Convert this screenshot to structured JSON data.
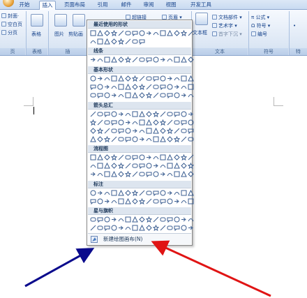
{
  "ribbon": {
    "tabs": [
      {
        "label": "开始",
        "active": false
      },
      {
        "label": "插入",
        "active": true
      },
      {
        "label": "页面布局",
        "active": false
      },
      {
        "label": "引用",
        "active": false
      },
      {
        "label": "邮件",
        "active": false
      },
      {
        "label": "审阅",
        "active": false
      },
      {
        "label": "视图",
        "active": false
      },
      {
        "label": "开发工具",
        "active": false
      }
    ],
    "pages_group": {
      "label": "页",
      "cover": "封面",
      "blank": "空白页",
      "page_break": "分页"
    },
    "table_group": {
      "label": "表格",
      "table": "表格"
    },
    "illus_group": {
      "label": "插",
      "picture": "图片",
      "clipart": "剪贴画",
      "shapes": "形状"
    },
    "links_group": {
      "hyperlink": "超链接"
    },
    "header_group": {
      "header": "页眉"
    },
    "text_group": {
      "label": "文本",
      "textbox": "文本框",
      "quickparts": "文档部件",
      "wordart": "艺术字",
      "dropcap": "首字下沉"
    },
    "symbols_group": {
      "label": "符号",
      "equation": "公式",
      "symbol": "符号",
      "number": "编号"
    },
    "special_group": {
      "label": "特"
    }
  },
  "shapes_panel": {
    "sections": [
      {
        "title": "最近使用的形状",
        "rows": 2
      },
      {
        "title": "线条",
        "rows": 1
      },
      {
        "title": "基本形状",
        "rows": 3
      },
      {
        "title": "箭头总汇",
        "rows": 4
      },
      {
        "title": "流程图",
        "rows": 3
      },
      {
        "title": "标注",
        "rows": 2
      },
      {
        "title": "星与旗帜",
        "rows": 2
      }
    ],
    "new_canvas": "新建绘图画布(N)"
  },
  "annotations": {
    "blue_arrow_color": "#0a0a8c",
    "red_arrow_color": "#e01414"
  }
}
